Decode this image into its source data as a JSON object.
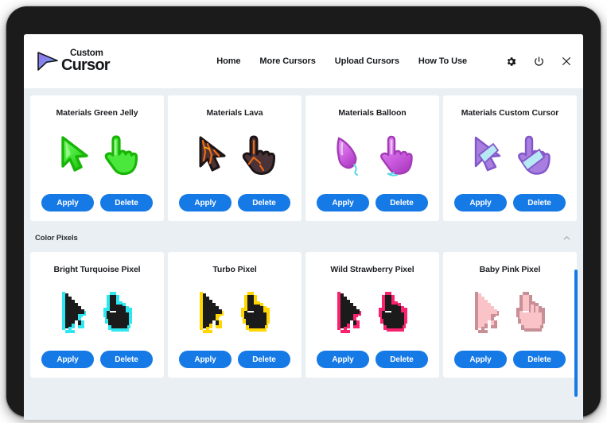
{
  "app": {
    "logo_top": "Custom",
    "logo_bottom": "Cursor",
    "logo_icon": "cursor-arrow-logo-icon"
  },
  "nav": {
    "links": [
      {
        "label": "Home",
        "name": "nav-home"
      },
      {
        "label": "More Cursors",
        "name": "nav-more-cursors"
      },
      {
        "label": "Upload Cursors",
        "name": "nav-upload-cursors"
      },
      {
        "label": "How To Use",
        "name": "nav-how-to-use"
      }
    ],
    "window_controls": [
      {
        "name": "gear-icon",
        "glyph": "settings"
      },
      {
        "name": "power-icon",
        "glyph": "power"
      },
      {
        "name": "close-icon",
        "glyph": "close"
      }
    ]
  },
  "buttons": {
    "apply": "Apply",
    "delete": "Delete"
  },
  "sections": [
    {
      "id": "materials",
      "header": null,
      "cards": [
        {
          "title": "Materials Green Jelly",
          "arrow_fill": "#44e035",
          "arrow_stroke": "#14b200",
          "hand_fill": "#5fe84f",
          "style": "jelly"
        },
        {
          "title": "Materials Lava",
          "arrow_fill": "#4a3338",
          "arrow_stroke": "#241a1c",
          "hand_fill": "#55373c",
          "style": "lava"
        },
        {
          "title": "Materials Balloon",
          "arrow_fill": "#cf5fe0",
          "arrow_stroke": "#a83cb8",
          "hand_fill": "#d76ae6",
          "style": "balloon"
        },
        {
          "title": "Materials Custom Cursor",
          "arrow_fill": "#a87ee0",
          "arrow_stroke": "#8a5fd0",
          "hand_fill": "#a87ee0",
          "style": "custom"
        }
      ]
    },
    {
      "id": "color-pixels",
      "header": {
        "title": "Color Pixels",
        "collapse_icon": "chevron-up-icon"
      },
      "cards": [
        {
          "title": "Bright Turquoise Pixel",
          "arrow_fill": "#1b1b1b",
          "arrow_stroke": "#2fe8ef",
          "hand_fill": "#1b1b1b",
          "style": "pixel"
        },
        {
          "title": "Turbo Pixel",
          "arrow_fill": "#1b1b1b",
          "arrow_stroke": "#ffd600",
          "hand_fill": "#1b1b1b",
          "style": "pixel"
        },
        {
          "title": "Wild Strawberry Pixel",
          "arrow_fill": "#1b1b1b",
          "arrow_stroke": "#f9226e",
          "hand_fill": "#1b1b1b",
          "style": "pixel"
        },
        {
          "title": "Baby Pink Pixel",
          "arrow_fill": "#f9c3c8",
          "arrow_stroke": "#c98f96",
          "hand_fill": "#f9c3c8",
          "style": "pixel"
        }
      ]
    }
  ],
  "colors": {
    "accent_blue": "#1579e6",
    "page_background": "#e9eff2",
    "card_background": "#ffffff",
    "bezel": "#1b1b1b"
  },
  "scrollbar": {
    "orientation": "vertical",
    "thumb_color": "#1579e6"
  }
}
